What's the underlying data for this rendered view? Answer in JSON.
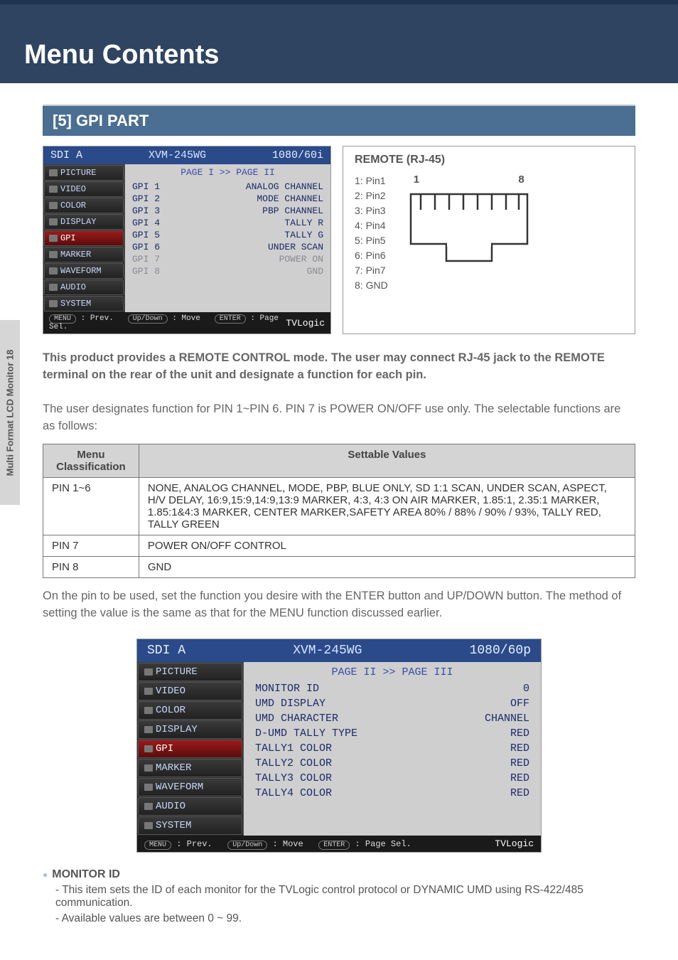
{
  "page_title": "Menu Contents",
  "sidebar_label": "Multi Format LCD Monitor 18",
  "section_header": "[5] GPI PART",
  "osd1": {
    "head_left": "SDI A",
    "head_center": "XVM-245WG",
    "head_right": "1080/60i",
    "menu": [
      "PICTURE",
      "VIDEO",
      "COLOR",
      "DISPLAY",
      "GPI",
      "MARKER",
      "WAVEFORM",
      "AUDIO",
      "SYSTEM"
    ],
    "selected_index": 4,
    "main_header": "PAGE I >> PAGE II",
    "rows": [
      {
        "l": "GPI 1",
        "r": "ANALOG CHANNEL",
        "dim": false
      },
      {
        "l": "GPI 2",
        "r": "MODE CHANNEL",
        "dim": false
      },
      {
        "l": "GPI 3",
        "r": "PBP CHANNEL",
        "dim": false
      },
      {
        "l": "GPI 4",
        "r": "TALLY R",
        "dim": false
      },
      {
        "l": "GPI 5",
        "r": "TALLY G",
        "dim": false
      },
      {
        "l": "GPI 6",
        "r": "UNDER SCAN",
        "dim": false
      },
      {
        "l": "GPI 7",
        "r": "POWER ON",
        "dim": true
      },
      {
        "l": "GPI 8",
        "r": "GND",
        "dim": true
      }
    ],
    "foot_left_1": "MENU",
    "foot_left_1b": ": Prev.",
    "foot_left_2": "Up/Down",
    "foot_left_2b": ": Move",
    "foot_left_3": "ENTER",
    "foot_left_3b": ": Page Sel.",
    "foot_right": "TVLogic"
  },
  "remote": {
    "title": "REMOTE (RJ-45)",
    "pins": [
      "1: Pin1",
      "2: Pin2",
      "3: Pin3",
      "4: Pin4",
      "5: Pin5",
      "6: Pin6",
      "7: Pin7",
      "8: GND"
    ],
    "label_left": "1",
    "label_right": "8"
  },
  "desc_bold": "This product provides a REMOTE CONTROL mode. The user may connect RJ-45 jack to the REMOTE terminal on the rear of the unit and designate a function for each pin.",
  "desc_body": "The user designates function for PIN 1~PIN 6.  PIN 7 is POWER ON/OFF use only. The selectable functions are as follows:",
  "table": {
    "head1": "Menu Classification",
    "head2": "Settable Values",
    "rows": [
      {
        "c1": "PIN 1~6",
        "c2": "NONE, ANALOG CHANNEL, MODE, PBP,  BLUE ONLY, SD 1:1 SCAN, UNDER SCAN, ASPECT, H/V DELAY, 16:9,15:9,14:9,13:9  MARKER, 4:3, 4:3 ON AIR MARKER, 1.85:1, 2.35:1 MARKER, 1.85:1&4:3 MARKER, CENTER MARKER,SAFETY AREA 80% / 88% / 90% / 93%, TALLY RED, TALLY GREEN"
      },
      {
        "c1": "PIN 7",
        "c2": "POWER ON/OFF CONTROL"
      },
      {
        "c1": "PIN 8",
        "c2": "GND"
      }
    ]
  },
  "desc_after": "On the pin to be used, set the function you desire with the ENTER button and UP/DOWN button. The method of setting the value is the same as that for the MENU function discussed earlier.",
  "osd2": {
    "head_left": "SDI A",
    "head_center": "XVM-245WG",
    "head_right": "1080/60p",
    "menu": [
      "PICTURE",
      "VIDEO",
      "COLOR",
      "DISPLAY",
      "GPI",
      "MARKER",
      "WAVEFORM",
      "AUDIO",
      "SYSTEM"
    ],
    "selected_index": 4,
    "main_header": "PAGE II >> PAGE III",
    "rows": [
      {
        "l": "MONITOR ID",
        "r": "0",
        "dim": false
      },
      {
        "l": "UMD DISPLAY",
        "r": "OFF",
        "dim": false
      },
      {
        "l": "UMD CHARACTER",
        "r": "CHANNEL",
        "dim": false
      },
      {
        "l": "D-UMD TALLY TYPE",
        "r": "RED",
        "dim": false
      },
      {
        "l": "TALLY1 COLOR",
        "r": "RED",
        "dim": false
      },
      {
        "l": "TALLY2 COLOR",
        "r": "RED",
        "dim": false
      },
      {
        "l": "TALLY3 COLOR",
        "r": "RED",
        "dim": false
      },
      {
        "l": "TALLY4 COLOR",
        "r": "RED",
        "dim": false
      }
    ],
    "foot_left_1": "MENU",
    "foot_left_1b": ": Prev.",
    "foot_left_2": "Up/Down",
    "foot_left_2b": ": Move",
    "foot_left_3": "ENTER",
    "foot_left_3b": ": Page Sel.",
    "foot_right": "TVLogic"
  },
  "monitor_id": {
    "head": "MONITOR ID",
    "line1": "- This item sets the ID of each monitor for the TVLogic control protocol or DYNAMIC UMD using RS-422/485 communication.",
    "line2": "- Available values are between 0 ~ 99."
  }
}
